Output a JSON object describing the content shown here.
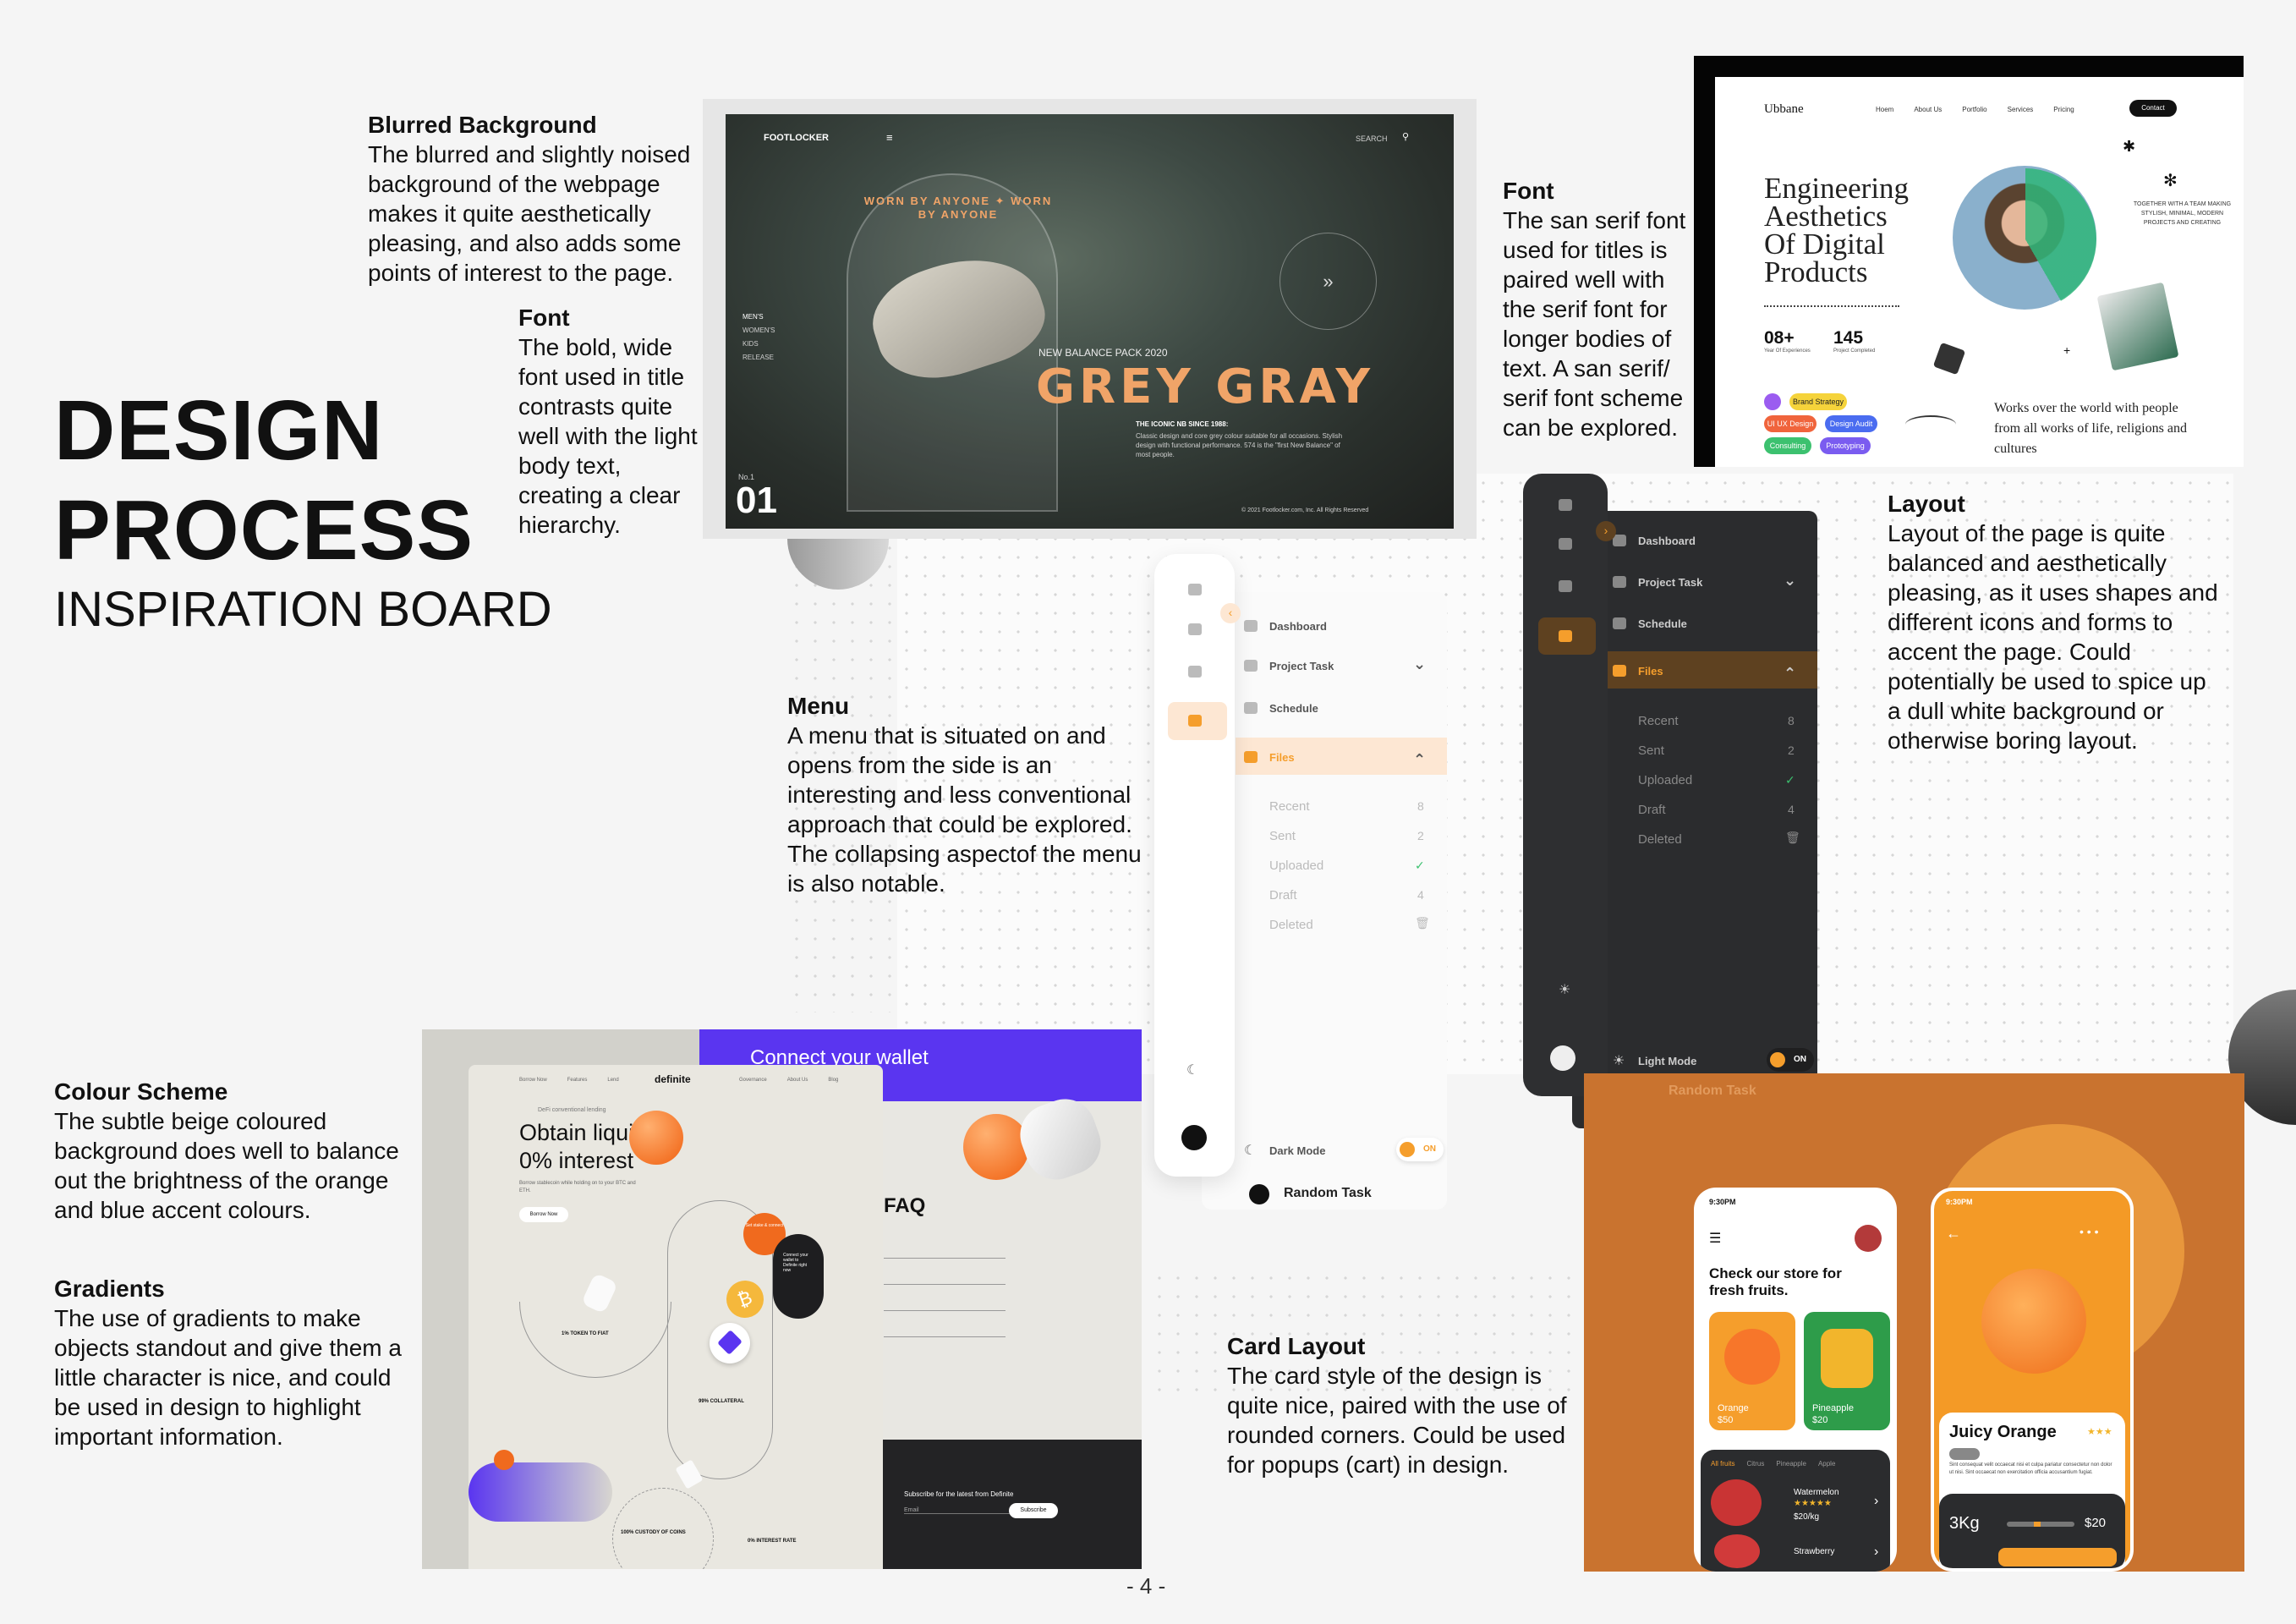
{
  "header": {
    "title_line1": "DESIGN",
    "title_line2": "PROCESS",
    "subtitle": "INSPIRATION BOARD"
  },
  "notes": {
    "blurred": {
      "title": "Blurred Background",
      "body": "The blurred and slightly noised background of the webpage makes it quite aesthetically pleasing, and also adds some points of interest to the page."
    },
    "font_left": {
      "title": "Font",
      "body": "The bold, wide font used in title contrasts quite well with the light body text, creating a clear hierarchy."
    },
    "font_right": {
      "title": "Font",
      "body": "The san serif font used for titles is paired well with the serif font for longer bodies of text. A san serif/ serif font scheme can be explored."
    },
    "layout": {
      "title": "Layout",
      "body": "Layout of the page is quite balanced and aesthetically pleasing, as it uses shapes and different icons and forms to accent the page. Could potentially be used to spice up a dull white background or otherwise boring layout."
    },
    "menu": {
      "title": "Menu",
      "body": "A menu that is situated on and opens from the side is an interesting and less conventional approach that could be explored. The collapsing aspectof the menu is also notable."
    },
    "colour": {
      "title": "Colour Scheme",
      "body": "The subtle beige coloured background does well to balance out the brightness of the orange and blue accent colours."
    },
    "gradients": {
      "title": "Gradients",
      "body": "The use of gradients to make objects standout and give them a little character is nice, and could be used in design to highlight important information."
    },
    "card": {
      "title": "Card Layout",
      "body": "The card style of the design is quite nice, paired with the use of rounded corners. Could be used for popups (cart) in design."
    }
  },
  "footlocker": {
    "brand": "FOOTLOCKER",
    "search": "SEARCH",
    "arch_text": "WORN BY ANYONE ✦ WORN BY ANYONE",
    "nav": [
      "MEN'S",
      "WOMEN'S",
      "KIDS",
      "RELEASE"
    ],
    "pack": "NEW BALANCE PACK 2020",
    "headline": "GREY GRAY",
    "since": "THE ICONIC NB SINCE 1988:",
    "desc": "Classic design and core grey colour suitable for all occasions. Stylish design with functional performance. 574 is the \"first New Balance\" of most people.",
    "no_label": "No.1",
    "no_big": "01",
    "arrow": "»",
    "copyright": "© 2021 Footlocker.com, Inc. All Rights Reserved"
  },
  "ubbane": {
    "brand": "Ubbane",
    "nav": [
      "Hoem",
      "About Us",
      "Portfolio",
      "Services",
      "Pricing"
    ],
    "contact": "Contact",
    "headline": "Engineering Aesthetics Of Digital Products",
    "stat1_value": "08+",
    "stat1_label": "Year Of Experiences",
    "stat2_value": "145",
    "stat2_label": "Project Completed",
    "right_caption": "TOGETHER WITH A TEAM MAKING STYLISH, MINIMAL, MODERN PROJECTS AND CREATING",
    "pills": [
      "Brand Strategy",
      "UI UX Design",
      "Design Audit",
      "Consulting",
      "Prototyping"
    ],
    "pill_colors": [
      "#f5d33b",
      "#f0643c",
      "#4a6cf0",
      "#3cc16f",
      "#7a5cf0"
    ],
    "quote": "Works over the world with people from all works of life, religions and cultures"
  },
  "menu_light": {
    "items": [
      "Dashboard",
      "Project Task",
      "Schedule",
      "Files"
    ],
    "sub": [
      {
        "label": "Recent",
        "value": "8"
      },
      {
        "label": "Sent",
        "value": "2"
      },
      {
        "label": "Uploaded",
        "value": "✓"
      },
      {
        "label": "Draft",
        "value": "4"
      },
      {
        "label": "Deleted",
        "value": "🗑"
      }
    ],
    "mode": "Dark Mode",
    "toggle": "ON",
    "task": "Random Task",
    "chevron_down": "⌄",
    "chevron_up": "⌃",
    "toggle_arrow": "‹"
  },
  "menu_dark": {
    "items": [
      "Dashboard",
      "Project Task",
      "Schedule",
      "Files"
    ],
    "sub": [
      {
        "label": "Recent",
        "value": "8"
      },
      {
        "label": "Sent",
        "value": "2"
      },
      {
        "label": "Uploaded",
        "value": "✓"
      },
      {
        "label": "Draft",
        "value": "4"
      },
      {
        "label": "Deleted",
        "value": "🗑"
      }
    ],
    "mode": "Light Mode",
    "toggle": "ON",
    "task": "Random Task",
    "chevron_down": "⌄",
    "chevron_up": "⌃",
    "toggle_arrow": "›",
    "sun": "☀"
  },
  "fruit_app": {
    "time": "9:30PM",
    "menu": "☰",
    "back": "←",
    "dots": "• • •",
    "heading": "Check our store for fresh fruits.",
    "card1_name": "Orange",
    "card1_price": "$50",
    "card2_name": "Pineapple",
    "card2_price": "$20",
    "tabs": [
      "All fruits",
      "Citrus",
      "Pineapple",
      "Apple"
    ],
    "row1_name": "Watermelon",
    "row1_price": "$20/kg",
    "row2_name": "Strawberry",
    "arrow": "›",
    "stars": "★★★★★",
    "stars_short": "★★★",
    "detail_title": "Juicy Orange",
    "detail_desc": "Sint consequat velit occaecat nisi et culpa pariatur consectetur non dolor ut nisi. Sint occaecat non exercitation officia accusantium fugiat.",
    "qty": "3Kg",
    "price": "$20"
  },
  "definite": {
    "brand": "definite",
    "nav_left": [
      "Borrow Now",
      "Features",
      "Lend",
      "Governance",
      "About Us",
      "Blog"
    ],
    "connect": "Connect your wallet",
    "tagline": "DeFi conventional lending",
    "headline": "Obtain liquity at 0% interest",
    "subtext": "Borrow stablecoin while holding on to your BTC and ETH.",
    "cta": "Borrow Now",
    "faq": "FAQ",
    "token": "1% TOKEN TO FIAT",
    "collateral": "99% COLLATERAL",
    "custody": "100% CUSTODY OF COINS",
    "interest": "0% INTEREST RATE",
    "subscribe": "Subscribe for the latest from Definite",
    "email": "Email",
    "subscribe_btn": "Subscribe",
    "bubble_dark": "Connect your wallet to Definite right now",
    "bubble_orange": "Set stake & connect",
    "token_symbol": "₿"
  },
  "footer": {
    "page": "- 4 -"
  }
}
